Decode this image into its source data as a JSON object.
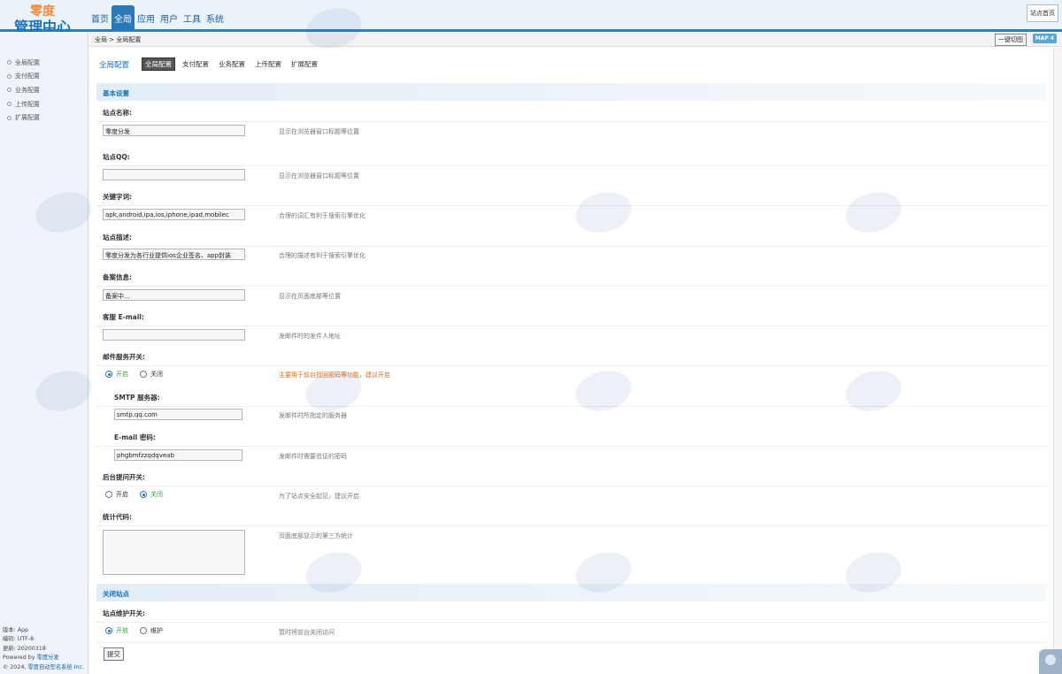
{
  "logo": {
    "line1": "零度",
    "line2": "管理中心"
  },
  "topnav": {
    "items": [
      "首页",
      "全局",
      "应用",
      "用户",
      "工具",
      "系统"
    ],
    "active_index": 1,
    "home_button": "站点首页"
  },
  "sidebar": {
    "items": [
      "全局配置",
      "支付配置",
      "业务配置",
      "上传配置",
      "扩展配置"
    ],
    "footer": {
      "version": "版本: App",
      "encoding": "编码: UTF-8",
      "updated": "更新: 20200318",
      "powered_prefix": "Powered by",
      "powered_link": "零度分发",
      "copyright_prefix": "© 2024,",
      "copyright_link": "零度自动签名系统 Inc."
    }
  },
  "breadcrumb": {
    "text": "全局 > 全局配置",
    "onekey_button": "一键切图",
    "map_button": "MAP 4"
  },
  "subtabs": {
    "title": "全局配置",
    "tabs": [
      "全局配置",
      "支付配置",
      "业务配置",
      "上传配置",
      "扩展配置"
    ],
    "active_index": 0
  },
  "sections": {
    "basic": "基本设置",
    "close": "关闭站点"
  },
  "form": {
    "site_name": {
      "label": "站点名称:",
      "value": "零度分发",
      "hint": "显示在浏览器窗口标题等位置"
    },
    "site_qq": {
      "label": "站点QQ:",
      "value": "",
      "hint": "显示在浏览器窗口标题等位置"
    },
    "keywords": {
      "label": "关键字词:",
      "value": "apk,android,ipa,ios,iphone,ipad,mobilec",
      "hint": "合理的词汇有利于搜索引擎优化"
    },
    "description": {
      "label": "站点描述:",
      "value": "零度分发为各行业提供ios企业签名、app封装",
      "hint": "合理的描述有利于搜索引擎优化"
    },
    "icp": {
      "label": "备案信息:",
      "value": "备案中...",
      "hint": "显示在页面底部等位置"
    },
    "service_email": {
      "label": "客服 E-mail:",
      "value": "",
      "hint": "发邮件时的发件人地址"
    },
    "mail_switch": {
      "label": "邮件服务开关:",
      "on": "开启",
      "off": "关闭",
      "selected": "on",
      "hint": "主要用于前台找回密码等功能，建议开启"
    },
    "smtp_server": {
      "label": "SMTP 服务器:",
      "value": "smtp.qq.com",
      "hint": "发邮件时所指定的服务器"
    },
    "email_password": {
      "label": "E-mail 密码:",
      "value": "phgbmfzzqdqveab",
      "hint": "发邮件时需要验证的密码"
    },
    "admin_question": {
      "label": "后台提问开关:",
      "on": "开启",
      "off": "关闭",
      "selected": "off",
      "hint": "为了站点安全起见，建议开启"
    },
    "stats_code": {
      "label": "统计代码:",
      "value": "",
      "hint": "页面底部显示的第三方统计"
    },
    "maintenance": {
      "label": "站点维护开关:",
      "on": "开放",
      "off": "维护",
      "selected": "on",
      "hint": "暂时将前台关闭访问"
    },
    "submit": "提交"
  },
  "colors": {
    "accent": "#2a78b8",
    "header_bg": "#eaf2fa",
    "warn": "#e06a14",
    "on_green": "#2eaa2e"
  }
}
